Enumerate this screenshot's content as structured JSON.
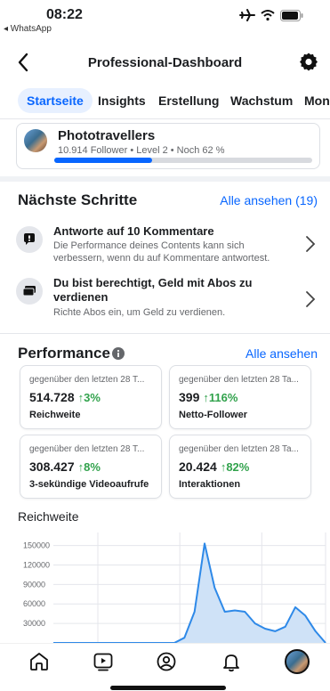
{
  "status": {
    "time": "08:22",
    "back_app": "◂ WhatsApp"
  },
  "nav": {
    "title": "Professional-Dashboard"
  },
  "tabs": [
    {
      "label": "Startseite",
      "active": true
    },
    {
      "label": "Insights",
      "active": false
    },
    {
      "label": "Erstellung",
      "active": false
    },
    {
      "label": "Wachstum",
      "active": false
    },
    {
      "label": "Mon",
      "active": false
    }
  ],
  "profile": {
    "name": "Phototravellers",
    "meta": "10.914 Follower • Level 2 • Noch 62 %",
    "progress": 0.38
  },
  "next_steps": {
    "title": "Nächste Schritte",
    "link": "Alle ansehen (19)",
    "items": [
      {
        "title": "Antworte auf 10 Kommentare",
        "desc": "Die Performance deines Contents kann sich verbessern, wenn du auf Kommentare antwortest.",
        "icon": "comment-icon"
      },
      {
        "title": "Du bist berechtigt, Geld mit Abos zu verdienen",
        "desc": "Richte Abos ein, um Geld zu verdienen.",
        "icon": "cards-icon"
      }
    ]
  },
  "performance": {
    "title": "Performance",
    "link": "Alle ansehen",
    "metrics": [
      {
        "sub": "gegenüber den letzten 28 T...",
        "value": "514.728",
        "delta": "↑3%",
        "label": "Reichweite"
      },
      {
        "sub": "gegenüber den letzten 28 Ta...",
        "value": "399",
        "delta": "↑116%",
        "label": "Netto-Follower"
      },
      {
        "sub": "gegenüber den letzten 28 T...",
        "value": "308.427",
        "delta": "↑8%",
        "label": "3-sekündige Videoaufrufe"
      },
      {
        "sub": "gegenüber den letzten 28 Ta...",
        "value": "20.424",
        "delta": "↑82%",
        "label": "Interaktionen"
      }
    ]
  },
  "chart_title": "Reichweite",
  "chart_data": {
    "type": "area",
    "title": "Reichweite",
    "y_ticks": [
      "150000",
      "120000",
      "90000",
      "60000",
      "30000"
    ],
    "ylim": [
      0,
      170000
    ],
    "grid": true,
    "x": [
      1,
      2,
      3,
      4,
      5,
      6,
      7,
      8,
      9,
      10,
      11,
      12,
      13,
      14,
      15,
      16,
      17,
      18,
      19,
      20,
      21,
      22,
      23,
      24,
      25,
      26,
      27,
      28
    ],
    "values": [
      0,
      0,
      0,
      0,
      0,
      0,
      0,
      0,
      0,
      0,
      0,
      0,
      0,
      8000,
      48000,
      153000,
      85000,
      48000,
      50000,
      48000,
      30000,
      22000,
      18000,
      25000,
      55000,
      42000,
      18000,
      0
    ],
    "colors": {
      "line": "#2e89e8",
      "fill": "#cfe2f7"
    }
  },
  "bottom_nav": [
    "home-icon",
    "video-icon",
    "profile-icon",
    "bell-icon",
    "avatar-icon"
  ]
}
